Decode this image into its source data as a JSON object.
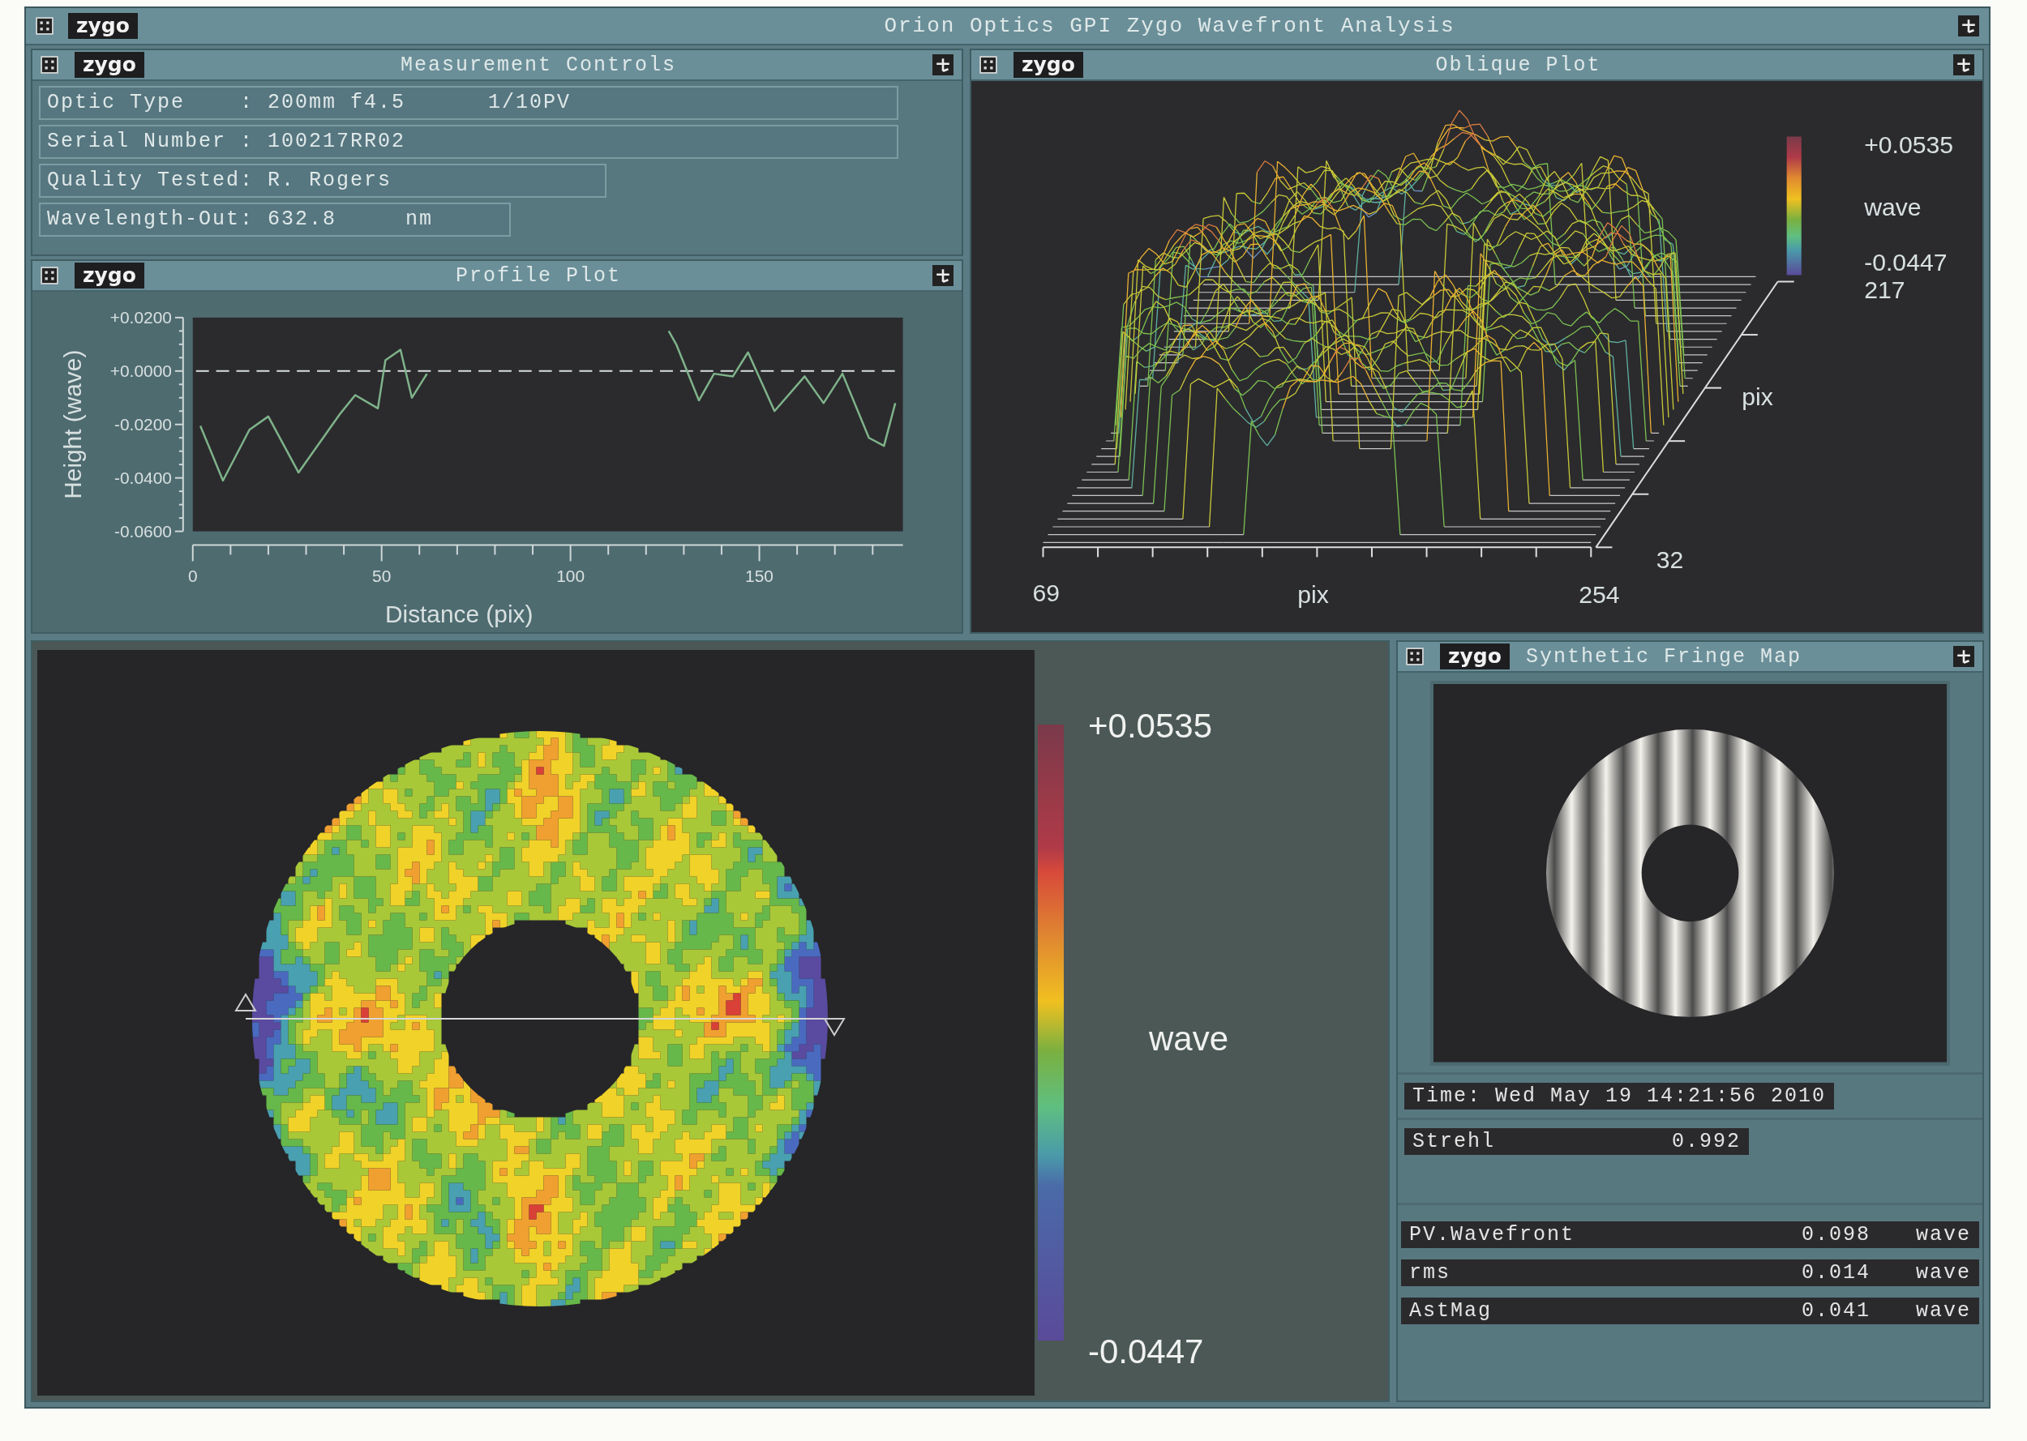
{
  "window": {
    "logo": "zygo",
    "title": "Orion Optics GPI Zygo Wavefront Analysis"
  },
  "measurement_controls": {
    "logo": "zygo",
    "title": "Measurement Controls",
    "fields": [
      {
        "text": "Optic Type    : 200mm f4.5      1/10PV"
      },
      {
        "text": "Serial Number : 100217RR02"
      },
      {
        "text": "Quality Tested: R. Rogers"
      },
      {
        "text": "Wavelength-Out: 632.8     nm"
      }
    ]
  },
  "profile_plot": {
    "logo": "zygo",
    "title": "Profile Plot",
    "chart_data": {
      "type": "line",
      "xlabel": "Distance (pix)",
      "ylabel": "Height (wave)",
      "x": [
        2,
        8,
        15,
        20,
        28,
        39,
        43,
        49,
        51,
        55,
        58,
        62,
        126,
        128,
        134,
        138,
        143,
        147,
        154,
        162,
        167,
        172,
        179,
        183,
        186
      ],
      "series": [
        {
          "color": "#7fb38a",
          "values": [
            -0.0205,
            -0.041,
            -0.022,
            -0.017,
            -0.038,
            -0.016,
            -0.009,
            -0.014,
            0.004,
            0.008,
            -0.01,
            -0.001,
            0.015,
            0.01,
            -0.011,
            -0.001,
            -0.002,
            0.007,
            -0.015,
            -0.002,
            -0.012,
            -0.001,
            -0.025,
            -0.028,
            -0.012
          ]
        }
      ],
      "xlim": [
        0,
        188
      ],
      "ylim": [
        -0.06,
        0.02
      ],
      "xticks": [
        0,
        50,
        100,
        150
      ],
      "yticks": [
        {
          "value": 0.02,
          "label": "+0.0200"
        },
        {
          "value": 0,
          "label": "+0.0000"
        },
        {
          "value": -0.02,
          "label": "-0.0200"
        },
        {
          "value": -0.04,
          "label": "-0.0400"
        },
        {
          "value": -0.06,
          "label": "-0.0600"
        }
      ]
    }
  },
  "oblique_plot": {
    "logo": "zygo",
    "title": "Oblique Plot",
    "scale_max": "+0.0535",
    "scale_unit": "wave",
    "scale_min": "-0.0447",
    "z_label": "217",
    "y_label": "pix",
    "y_start": "32",
    "x_start": "69",
    "x_label": "pix",
    "x_end": "254"
  },
  "surface_map": {
    "scale_max": "+0.0535",
    "scale_unit": "wave",
    "scale_min": "-0.0447"
  },
  "fringe_map": {
    "logo": "zygo",
    "title": "Synthetic Fringe Map",
    "time": "Time: Wed May 19 14:21:56 2010",
    "strehl": {
      "label": "Strehl",
      "value": "0.992"
    },
    "results": [
      {
        "label": "PV.Wavefront",
        "value": "0.098",
        "unit": "wave"
      },
      {
        "label": "rms",
        "value": "0.014",
        "unit": "wave"
      },
      {
        "label": "AstMag",
        "value": "0.041",
        "unit": "wave"
      }
    ]
  }
}
